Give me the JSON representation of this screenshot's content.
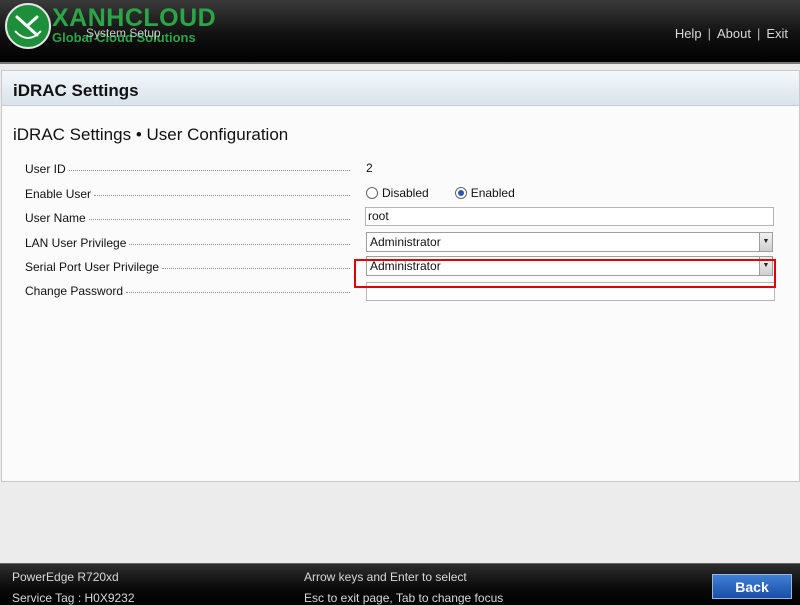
{
  "header": {
    "logo_text": "XANHCLOUD",
    "logo_subtext": "Global Cloud Solutions",
    "title": "System Setup",
    "links": [
      "Help",
      "About",
      "Exit"
    ]
  },
  "page": {
    "title": "iDRAC Settings",
    "subtitle": "iDRAC Settings • User Configuration"
  },
  "form": {
    "user_id": {
      "label": "User ID",
      "value": "2"
    },
    "enable_user": {
      "label": "Enable User",
      "options": [
        "Disabled",
        "Enabled"
      ],
      "selected": "Enabled"
    },
    "user_name": {
      "label": "User Name",
      "value": "root"
    },
    "lan_privilege": {
      "label": "LAN User Privilege",
      "value": "Administrator"
    },
    "serial_privilege": {
      "label": "Serial Port User Privilege",
      "value": "Administrator"
    },
    "change_password": {
      "label": "Change Password",
      "value": ""
    }
  },
  "footer": {
    "model": "PowerEdge R720xd",
    "service_tag": "Service Tag : H0X9232",
    "hint1": "Arrow keys and Enter to select",
    "hint2": "Esc to exit page, Tab to change focus",
    "back_label": "Back"
  },
  "colors": {
    "highlight": "#e00000",
    "logo_green": "#2aa646",
    "back_button": "#1a4ea6"
  }
}
